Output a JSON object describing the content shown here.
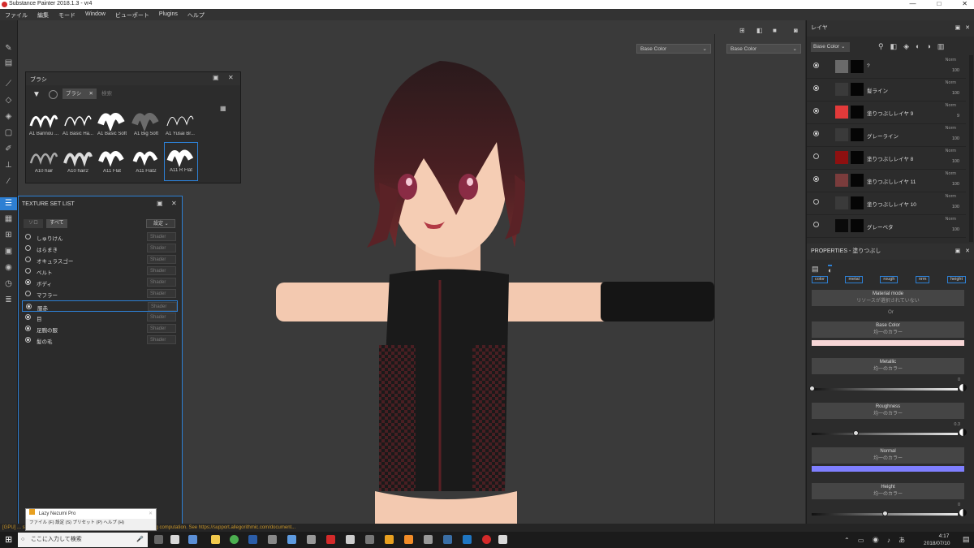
{
  "window": {
    "title": "Substance Painter 2018.1.3 - vr4",
    "min": "—",
    "max": "□",
    "close": "✕"
  },
  "menu": [
    "ファイル",
    "編集",
    "モード",
    "Window",
    "ビューポート",
    "Plugins",
    "ヘルプ"
  ],
  "viewport": {
    "left_channel": "Base Color",
    "right_channel": "Base Color"
  },
  "brush_panel": {
    "title": "ブラシ",
    "filter_tag": "ブラシ",
    "search_placeholder": "検索",
    "brushes": [
      "A1 Bannou ...",
      "A1 Basic Ha...",
      "A1 Basic Soft",
      "A1 Big Soft",
      "A1 Yusai Br...",
      "A10 hair",
      "A10 hair2",
      "A11 Flat",
      "A11 Flat2",
      "A11 R Flat"
    ]
  },
  "texture_set_list": {
    "title": "TEXTURE SET LIST",
    "solo_label": "ソロ",
    "all_label": "すべて",
    "settings_label": "設定",
    "shader_label": "Shader",
    "items": [
      {
        "name": "しゅりけん",
        "visible": false
      },
      {
        "name": "はらまき",
        "visible": false
      },
      {
        "name": "オキュラスゴー",
        "visible": false
      },
      {
        "name": "ベルト",
        "visible": false
      },
      {
        "name": "ボディ",
        "visible": true
      },
      {
        "name": "マフラー",
        "visible": false
      },
      {
        "name": "服赤",
        "visible": true
      },
      {
        "name": "目",
        "visible": true
      },
      {
        "name": "足腕の服",
        "visible": true
      },
      {
        "name": "髪の毛",
        "visible": true
      }
    ]
  },
  "layers": {
    "title": "レイヤ",
    "channel": "Base Color",
    "items": [
      {
        "name": "?",
        "blend": "Norm",
        "opacity": "100",
        "visible": true,
        "color": "#6a6a6a"
      },
      {
        "name": "髪ライン",
        "blend": "Norm",
        "opacity": "100",
        "visible": true,
        "color": "#3a3a3a"
      },
      {
        "name": "塗りつぶしレイヤ 9",
        "blend": "Norm",
        "opacity": "9",
        "visible": true,
        "color": "#e23a3a"
      },
      {
        "name": "グレーライン",
        "blend": "Norm",
        "opacity": "100",
        "visible": true,
        "color": "#3a3a3a"
      },
      {
        "name": "塗りつぶしレイヤ 8",
        "blend": "Norm",
        "opacity": "100",
        "visible": false,
        "color": "#8e1010"
      },
      {
        "name": "塗りつぶしレイヤ 11",
        "blend": "Norm",
        "opacity": "100",
        "visible": true,
        "color": "#7a3c3c"
      },
      {
        "name": "塗りつぶしレイヤ 10",
        "blend": "Norm",
        "opacity": "100",
        "visible": false,
        "color": "#3a3a3a"
      },
      {
        "name": "グレーベタ",
        "blend": "Norm",
        "opacity": "100",
        "visible": false,
        "color": "#0a0a0a"
      }
    ]
  },
  "properties": {
    "title": "PROPERTIES - 塗りつぶし",
    "channels": [
      "color",
      "metal",
      "rough",
      "nrm",
      "height"
    ],
    "material_mode": "Material mode",
    "no_resource": "リソースが選択されていない",
    "or": "Or",
    "uniform": "均一のカラー",
    "base_color": "Base Color",
    "metallic": "Metallic",
    "metallic_value": "0",
    "metallic_level": 0,
    "roughness": "Roughness",
    "roughness_value": "0.3",
    "roughness_level": 0.3,
    "normal": "Normal",
    "height": "Height",
    "height_value": "0",
    "height_level": 0.5,
    "base_color_hex": "#f7d6d6",
    "normal_hex": "#7f7fff"
  },
  "status": "[GPU] ... stance Painter can be interrupted by the OS when doing a long computation. See https://support.allegorithmic.com/document...",
  "lazy": {
    "title": "Lazy Nezumi Pro",
    "menu": "ファイル (F)   設定 (S)   プリセット (P)   ヘルプ (H)"
  },
  "taskbar": {
    "search": "ここに入力して検索",
    "time": "4:17",
    "date": "2018/07/10"
  }
}
